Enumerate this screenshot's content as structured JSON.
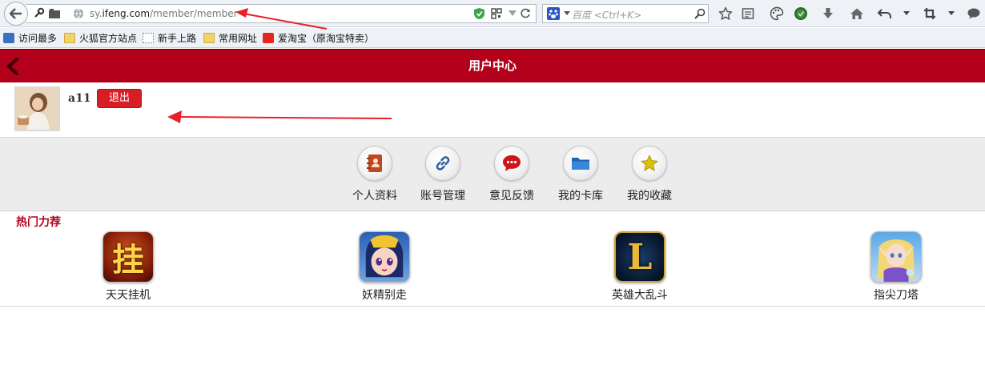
{
  "browser": {
    "url_prefix": "sy.",
    "url_domain": "ifeng.com",
    "url_path": "/member/member",
    "search_placeholder": "百度 <Ctrl+K>"
  },
  "bookmarks": [
    {
      "label": "访问最多",
      "icon": "search-bookmark-icon"
    },
    {
      "label": "火狐官方站点",
      "icon": "folder-icon"
    },
    {
      "label": "新手上路",
      "icon": "dotted-page-icon"
    },
    {
      "label": "常用网址",
      "icon": "folder-icon"
    },
    {
      "label": "爱淘宝（原淘宝特卖）",
      "icon": "taobao-icon"
    }
  ],
  "header": {
    "title": "用户中心"
  },
  "user": {
    "name": "a11",
    "logout_label": "退出"
  },
  "menu": [
    {
      "label": "个人资料",
      "icon": "contacts-book-icon",
      "color": "#c0471f"
    },
    {
      "label": "账号管理",
      "icon": "link-icon",
      "color": "#2f5f9e"
    },
    {
      "label": "意见反馈",
      "icon": "speech-bubble-icon",
      "color": "#d0141c"
    },
    {
      "label": "我的卡库",
      "icon": "folder-icon",
      "color": "#1f63b8"
    },
    {
      "label": "我的收藏",
      "icon": "star-icon",
      "color": "#e2c000"
    }
  ],
  "hot": {
    "title": "热门力荐",
    "games": [
      {
        "name": "天天挂机",
        "glyph": "挂"
      },
      {
        "name": "妖精别走",
        "glyph": ""
      },
      {
        "name": "英雄大乱斗",
        "glyph": "L"
      },
      {
        "name": "指尖刀塔",
        "glyph": ""
      }
    ]
  },
  "colors": {
    "brand_red": "#b3001b",
    "button_red": "#d81e25",
    "arrow_red": "#e8202a"
  }
}
